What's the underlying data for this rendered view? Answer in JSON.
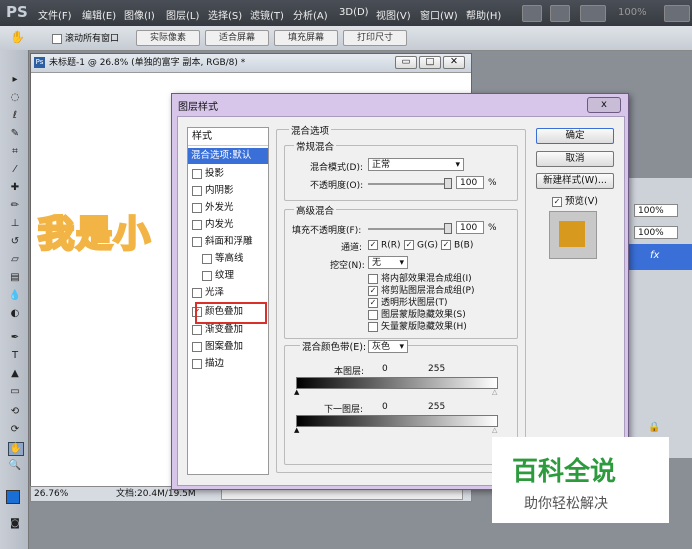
{
  "app": {
    "logo": "PS"
  },
  "menu": [
    "文件(F)",
    "编辑(E)",
    "图像(I)",
    "图层(L)",
    "选择(S)",
    "滤镜(T)",
    "分析(A)",
    "3D(D)",
    "视图(V)",
    "窗口(W)",
    "帮助(H)"
  ],
  "menu_zoom": "100%",
  "options": {
    "scroll_all": "滚动所有窗口",
    "actual_pixels": "实际像素",
    "fit_screen": "适合屏幕",
    "fill_screen": "填充屏幕",
    "print_size": "打印尺寸"
  },
  "document": {
    "title": "未标题-1 @ 26.8% (单独的富字 副本, RGB/8) *",
    "canvas_text": "我是小",
    "zoom": "26.76%",
    "doc_info": "文档:20.4M/19.5M"
  },
  "right_panel": {
    "opacity1": "100%",
    "opacity2": "100%",
    "fx": "fx"
  },
  "dialog": {
    "title": "图层样式",
    "close": "x",
    "styles_header": "样式",
    "selected_item": "混合选项:默认",
    "items": [
      {
        "label": "投影",
        "checked": false
      },
      {
        "label": "内阴影",
        "checked": false
      },
      {
        "label": "外发光",
        "checked": false
      },
      {
        "label": "内发光",
        "checked": false
      },
      {
        "label": "斜面和浮雕",
        "checked": false
      },
      {
        "label": "等高线",
        "checked": false
      },
      {
        "label": "纹理",
        "checked": false
      },
      {
        "label": "光泽",
        "checked": false
      },
      {
        "label": "颜色叠加",
        "checked": true
      },
      {
        "label": "渐变叠加",
        "checked": false
      },
      {
        "label": "图案叠加",
        "checked": false
      },
      {
        "label": "描边",
        "checked": false
      }
    ],
    "blend_options_title": "混合选项",
    "general_title": "常规混合",
    "blend_mode_label": "混合模式(D):",
    "blend_mode_value": "正常",
    "opacity_label": "不透明度(O):",
    "opacity_value": "100",
    "percent": "%",
    "advanced_title": "高级混合",
    "fill_opacity_label": "填充不透明度(F):",
    "fill_opacity_value": "100",
    "channels_label": "通道:",
    "channel_r": "R(R)",
    "channel_g": "G(G)",
    "channel_b": "B(B)",
    "knockout_label": "挖空(N):",
    "knockout_value": "无",
    "adv_checks": [
      {
        "label": "将内部效果混合成组(I)",
        "checked": false
      },
      {
        "label": "将剪贴图层混合成组(P)",
        "checked": true
      },
      {
        "label": "透明形状图层(T)",
        "checked": true
      },
      {
        "label": "图层蒙版隐藏效果(S)",
        "checked": false
      },
      {
        "label": "矢量蒙版隐藏效果(H)",
        "checked": false
      }
    ],
    "blend_if_label": "混合颜色带(E):",
    "blend_if_value": "灰色",
    "this_layer_label": "本图层:",
    "this_layer_min": "0",
    "this_layer_max": "255",
    "underlying_label": "下一图层:",
    "underlying_min": "0",
    "underlying_max": "255",
    "ok": "确定",
    "cancel": "取消",
    "new_style": "新建样式(W)...",
    "preview_label": "预览(V)",
    "preview_color": "#d89a1e"
  },
  "watermark": {
    "title": "百科全说",
    "subtitle": "助你轻松解决",
    "color": "#2e9a3e"
  }
}
